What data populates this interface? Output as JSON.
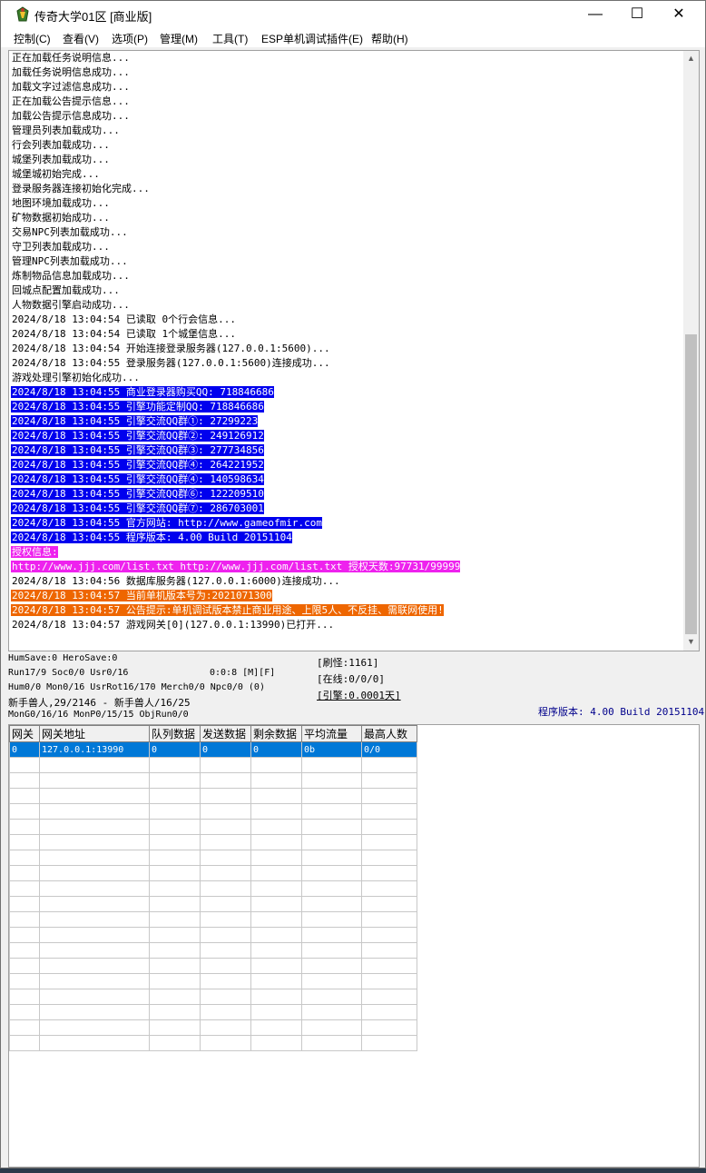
{
  "window": {
    "title": "传奇大学01区 [商业版]",
    "minimize_glyph": "—",
    "maximize_glyph": "☐",
    "close_glyph": "✕"
  },
  "menu": [
    {
      "label": "控制(C)"
    },
    {
      "label": "查看(V)"
    },
    {
      "label": "选项(P)"
    },
    {
      "label": "管理(M)"
    },
    {
      "label": "工具(T)"
    },
    {
      "label": "ESP单机调试插件(E)"
    },
    {
      "label": "帮助(H)"
    }
  ],
  "log": [
    {
      "text": "正在加载任务说明信息...",
      "hl": ""
    },
    {
      "text": "加载任务说明信息成功...",
      "hl": ""
    },
    {
      "text": "加载文字过滤信息成功...",
      "hl": ""
    },
    {
      "text": "正在加载公告提示信息...",
      "hl": ""
    },
    {
      "text": "加载公告提示信息成功...",
      "hl": ""
    },
    {
      "text": "管理员列表加载成功...",
      "hl": ""
    },
    {
      "text": "行会列表加载成功...",
      "hl": ""
    },
    {
      "text": "城堡列表加载成功...",
      "hl": ""
    },
    {
      "text": "城堡城初始完成...",
      "hl": ""
    },
    {
      "text": "登录服务器连接初始化完成...",
      "hl": ""
    },
    {
      "text": "地图环境加载成功...",
      "hl": ""
    },
    {
      "text": "矿物数据初始成功...",
      "hl": ""
    },
    {
      "text": "交易NPC列表加载成功...",
      "hl": ""
    },
    {
      "text": "守卫列表加载成功...",
      "hl": ""
    },
    {
      "text": "管理NPC列表加载成功...",
      "hl": ""
    },
    {
      "text": "炼制物品信息加载成功...",
      "hl": ""
    },
    {
      "text": "回城点配置加载成功...",
      "hl": ""
    },
    {
      "text": "人物数据引擎启动成功...",
      "hl": ""
    },
    {
      "text": "2024/8/18 13:04:54 已读取 0个行会信息...",
      "hl": ""
    },
    {
      "text": "2024/8/18 13:04:54 已读取 1个城堡信息...",
      "hl": ""
    },
    {
      "text": "2024/8/18 13:04:54 开始连接登录服务器(127.0.0.1:5600)...",
      "hl": ""
    },
    {
      "text": "2024/8/18 13:04:55 登录服务器(127.0.0.1:5600)连接成功...",
      "hl": ""
    },
    {
      "text": "游戏处理引擎初始化成功...",
      "hl": ""
    },
    {
      "text": "2024/8/18 13:04:55 商业登录器购买QQ: 718846686",
      "hl": "blue"
    },
    {
      "text": "2024/8/18 13:04:55 引擎功能定制QQ: 718846686",
      "hl": "blue"
    },
    {
      "text": "2024/8/18 13:04:55 引擎交流QQ群①: 27299223",
      "hl": "blue"
    },
    {
      "text": "2024/8/18 13:04:55 引擎交流QQ群②: 249126912",
      "hl": "blue"
    },
    {
      "text": "2024/8/18 13:04:55 引擎交流QQ群③: 277734856",
      "hl": "blue"
    },
    {
      "text": "2024/8/18 13:04:55 引擎交流QQ群④: 264221952",
      "hl": "blue"
    },
    {
      "text": "2024/8/18 13:04:55 引擎交流QQ群④: 140598634",
      "hl": "blue"
    },
    {
      "text": "2024/8/18 13:04:55 引擎交流QQ群⑥: 122209510",
      "hl": "blue"
    },
    {
      "text": "2024/8/18 13:04:55 引擎交流QQ群⑦: 286703001",
      "hl": "blue"
    },
    {
      "text": "2024/8/18 13:04:55 官方网站: http://www.gameofmir.com",
      "hl": "blue"
    },
    {
      "text": "2024/8/18 13:04:55 程序版本: 4.00 Build 20151104",
      "hl": "blue"
    },
    {
      "text": "授权信息:",
      "hl": "magenta"
    },
    {
      "text": "http://www.jjj.com/list.txt http://www.jjj.com/list.txt 授权天数:97731/99999",
      "hl": "magenta"
    },
    {
      "text": "2024/8/18 13:04:56 数据库服务器(127.0.0.1:6000)连接成功...",
      "hl": ""
    },
    {
      "text": "2024/8/18 13:04:57 当前单机版本号为:2021071300",
      "hl": "orange"
    },
    {
      "text": "2024/8/18 13:04:57 公告提示:单机调试版本禁止商业用途、上限5人、不反挂、需联网使用!",
      "hl": "orange"
    },
    {
      "text": "2024/8/18 13:04:57 游戏网关[0](127.0.0.1:13990)已打开...",
      "hl": ""
    }
  ],
  "scroll": {
    "up": "▲",
    "down": "▼"
  },
  "status": {
    "line1": "HumSave:0 HeroSave:0",
    "line2a": "Run17/9 Soc0/0 Usr0/16",
    "line2b": "0:0:8 [M][F]",
    "line3": "Hum0/0 Mon0/16 UsrRot16/170 Merch0/0 Npc0/0 (0)",
    "line4": "新手兽人,29/2146 - 新手兽人/16/25",
    "line5": "MonG0/16/16 MonP0/15/15 ObjRun0/0",
    "refresh": "[刷怪:1161]",
    "online": "[在线:0/0/0]",
    "engine": "[引擎:0.0001天]",
    "version": "程序版本: 4.00 Build 20151104"
  },
  "grid": {
    "headers": [
      "网关",
      "网关地址",
      "队列数据",
      "发送数据",
      "剩余数据",
      "平均流量",
      "最高人数"
    ],
    "rows": [
      [
        "0",
        "127.0.0.1:13990",
        "0",
        "0",
        "0",
        "0b",
        "0/0"
      ]
    ],
    "empty_rows": 19
  }
}
